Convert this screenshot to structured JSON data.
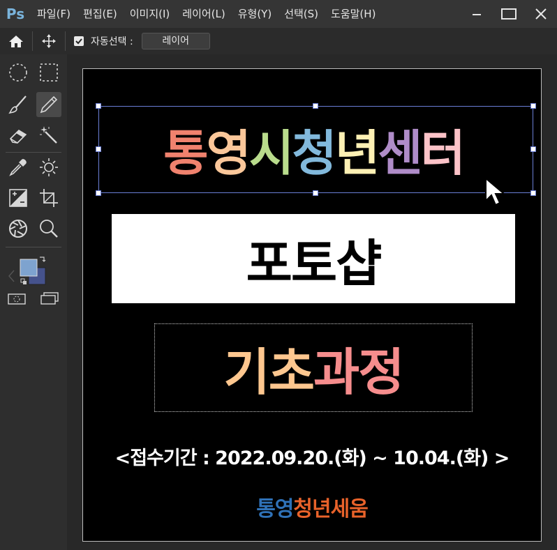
{
  "app": {
    "logo": "Ps"
  },
  "menu": [
    "파일(F)",
    "편집(E)",
    "이미지(I)",
    "레이어(L)",
    "유형(Y)",
    "선택(S)",
    "도움말(H)"
  ],
  "options": {
    "auto_select_label": "자동선택 :",
    "auto_select_value": "레이어",
    "auto_select_checked": true
  },
  "toolbar": {
    "icons": [
      "home-icon",
      "move-icon",
      "ellipse-marquee-icon",
      "rect-marquee-icon",
      "brush-icon",
      "pencil-icon",
      "eraser-icon",
      "magic-wand-icon",
      "eyedropper-icon",
      "brightness-icon",
      "levels-icon",
      "crop-icon",
      "aperture-icon",
      "zoom-icon",
      "color-swatch-icon",
      "quick-mask-icon",
      "screen-mode-icon"
    ],
    "foreground_color": "#7ea3cf",
    "background_color": "#45528c"
  },
  "canvas": {
    "title_chars": [
      {
        "ch": "통",
        "color": "#f0826e"
      },
      {
        "ch": "영",
        "color": "#fbc79a"
      },
      {
        "ch": "시",
        "color": "#b9dc8c"
      },
      {
        "ch": "청",
        "color": "#82b9dc"
      },
      {
        "ch": "년",
        "color": "#fdf0b4"
      },
      {
        "ch": "센",
        "color": "#af8cc8"
      },
      {
        "ch": "터",
        "color": "#fcc3c8"
      }
    ],
    "subtitle": "포토샵",
    "course_part1": "기초",
    "course_part1_color": "#fec78f",
    "course_part2": "과정",
    "course_part2_color": "#f68d8d",
    "period": "<접수기간 : 2022.09.20.(화) ~ 10.04.(화) >",
    "logo_part1": "통영",
    "logo_part1_color": "#2f72b8",
    "logo_part2": "청년세움",
    "logo_part2_color": "#e8622a"
  }
}
